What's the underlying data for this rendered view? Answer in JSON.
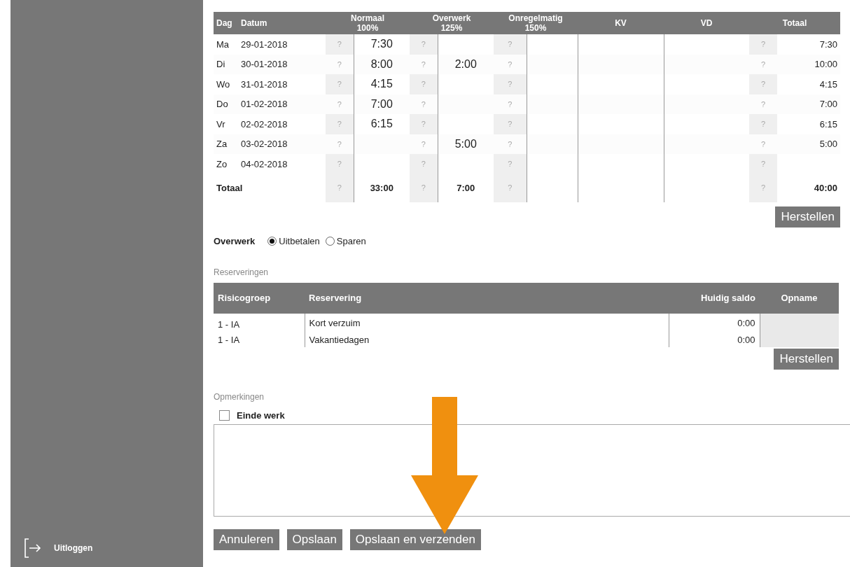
{
  "sidebar": {
    "logout_label": "Uitloggen"
  },
  "hours_table": {
    "columns": [
      {
        "label": "Dag"
      },
      {
        "label": "Datum"
      },
      {
        "label": "Normaal",
        "sub": "100%"
      },
      {
        "label": "Overwerk",
        "sub": "125%"
      },
      {
        "label": "Onregelmatig",
        "sub": "150%"
      },
      {
        "label": "KV"
      },
      {
        "label": "VD"
      },
      {
        "label": "Totaal"
      }
    ],
    "rows": [
      {
        "day": "Ma",
        "date": "29-01-2018",
        "help": [
          "?",
          "?",
          "?",
          "?"
        ],
        "normaal": "7:30",
        "totaal": "7:30"
      },
      {
        "day": "Di",
        "date": "30-01-2018",
        "help": [
          "?",
          "?",
          "?",
          "?"
        ],
        "normaal": "8:00",
        "overwerk": "2:00",
        "totaal": "10:00"
      },
      {
        "day": "Wo",
        "date": "31-01-2018",
        "help": [
          "?",
          "?",
          "?",
          "?"
        ],
        "normaal": "4:15",
        "totaal": "4:15"
      },
      {
        "day": "Do",
        "date": "01-02-2018",
        "help": [
          "?",
          "?",
          "?",
          "?"
        ],
        "normaal": "7:00",
        "totaal": "7:00"
      },
      {
        "day": "Vr",
        "date": "02-02-2018",
        "help": [
          "?",
          "?",
          "?",
          "?"
        ],
        "normaal": "6:15",
        "totaal": "6:15"
      },
      {
        "day": "Za",
        "date": "03-02-2018",
        "help": [
          "?",
          "?",
          "?",
          "?"
        ],
        "overwerk": "5:00",
        "totaal": "5:00"
      },
      {
        "day": "Zo",
        "date": "04-02-2018",
        "help": [
          "?",
          "?",
          "?",
          "?"
        ]
      }
    ],
    "total": {
      "label": "Totaal",
      "help": [
        "?",
        "?",
        "?",
        "?"
      ],
      "normaal": "33:00",
      "overwerk": "7:00",
      "totaal": "40:00"
    },
    "reset_button": "Herstellen"
  },
  "overtime": {
    "label": "Overwerk",
    "options": [
      {
        "label": "Uitbetalen",
        "selected": true
      },
      {
        "label": "Sparen",
        "selected": false
      }
    ]
  },
  "reservations": {
    "title": "Reserveringen",
    "columns": [
      "Risicogroep",
      "Reservering",
      "Huidig saldo",
      "Opname"
    ],
    "rows": [
      {
        "group": "1 - IA",
        "reservation": "Kort verzuim",
        "balance": "0:00"
      },
      {
        "group": "1 - IA",
        "reservation": "Vakantiedagen",
        "balance": "0:00"
      }
    ],
    "reset_button": "Herstellen"
  },
  "remarks": {
    "title": "Opmerkingen",
    "end_of_work": {
      "label": "Einde werk",
      "checked": false
    }
  },
  "actions": [
    "Annuleren",
    "Opslaan",
    "Opslaan en verzenden"
  ]
}
